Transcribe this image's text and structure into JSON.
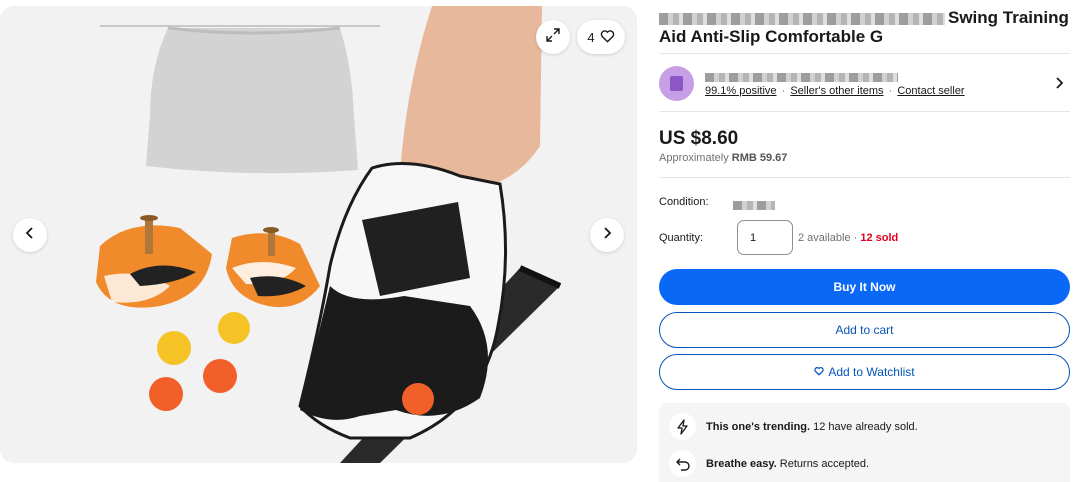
{
  "gallery": {
    "watch_count": "4"
  },
  "listing": {
    "title_visible": "Swing Training Aid Anti-Slip Comfortable G",
    "price": "US $8.60",
    "approx_prefix": "Approximately",
    "approx_value": "RMB 59.67"
  },
  "seller": {
    "positive": "99.1% positive",
    "other_items": "Seller's other items",
    "contact": "Contact seller",
    "separator": "·"
  },
  "details": {
    "condition_label": "Condition:",
    "quantity_label": "Quantity:",
    "quantity_value": "1",
    "available": "2 available",
    "separator": " · ",
    "sold": "12 sold"
  },
  "actions": {
    "buy_now": "Buy It Now",
    "add_to_cart": "Add to cart",
    "add_to_watchlist": "Add to Watchlist"
  },
  "highlights": {
    "trending_bold": "This one's trending.",
    "trending_text": " 12 have already sold.",
    "returns_bold": "Breathe easy.",
    "returns_text": " Returns accepted."
  },
  "colors": {
    "primary_blue": "#0968f6",
    "link_blue": "#0654ba",
    "sold_red": "#e0001e",
    "avatar_purple": "#c69fe6"
  }
}
